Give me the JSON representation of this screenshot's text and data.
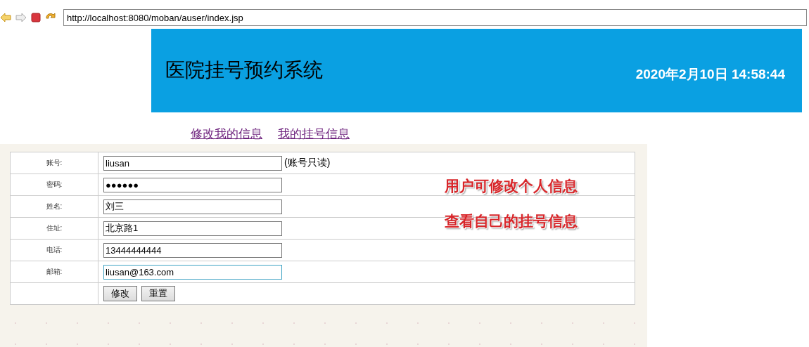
{
  "browser": {
    "address": "http://localhost:8080/moban/auser/index.jsp"
  },
  "header": {
    "title": "医院挂号预约系统",
    "datetime": "2020年2月10日 14:58:44"
  },
  "nav_links": [
    "修改我的信息",
    "我的挂号信息"
  ],
  "form": {
    "fields": [
      {
        "label": "账号:",
        "value": "liusan",
        "note": "(账号只读)",
        "focused": false
      },
      {
        "label": "密码:",
        "value": "●●●●●●",
        "focused": false
      },
      {
        "label": "姓名:",
        "value": "刘三",
        "focused": false
      },
      {
        "label": "住址:",
        "value": "北京路1",
        "focused": false
      },
      {
        "label": "电话:",
        "value": "13444444444",
        "focused": false
      },
      {
        "label": "邮箱:",
        "value": "liusan@163.com",
        "focused": true
      }
    ],
    "buttons": [
      "修改",
      "重置"
    ]
  },
  "annotations": [
    "用户可修改个人信息",
    "查看自己的挂号信息"
  ]
}
